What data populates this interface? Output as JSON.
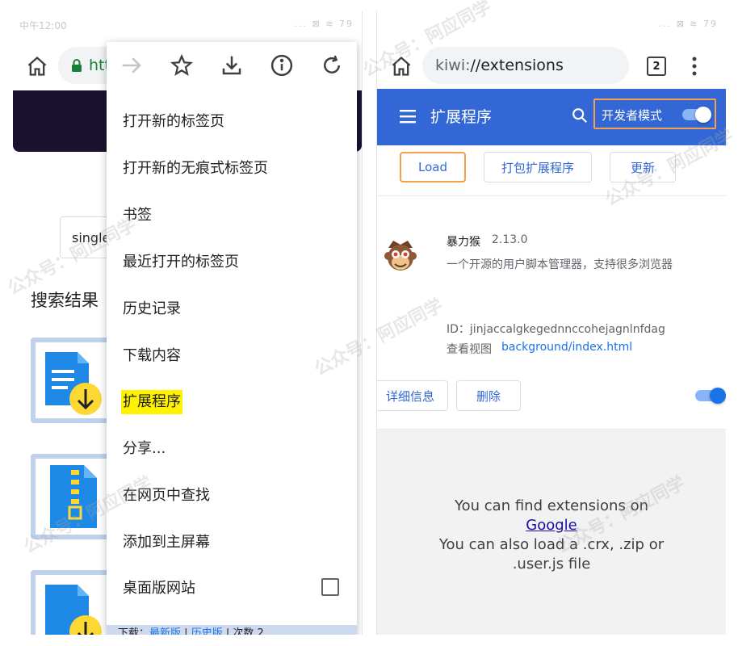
{
  "left_phone": {
    "status": {
      "time": "中午12:00",
      "sys": "... ⊠ ≋ 79"
    },
    "url_prefix": "htt",
    "search_value": "single",
    "results_title": "搜索结果",
    "menu": {
      "icons": [
        "forward-arrow-icon",
        "star-icon",
        "download-icon",
        "info-icon",
        "refresh-icon"
      ],
      "items": [
        "打开新的标签页",
        "打开新的无痕式标签页",
        "书签",
        "最近打开的标签页",
        "历史记录",
        "下载内容",
        "扩展程序",
        "分享...",
        "在网页中查找",
        "添加到主屏幕",
        "桌面版网站"
      ],
      "highlight_color": "#fff200",
      "bottom_strip": {
        "prefix": "下载：",
        "link1": "最新版",
        "sep": " | ",
        "link2": "历史版",
        "suffix": " | 次数 2"
      }
    }
  },
  "right_phone": {
    "status": {
      "time": "",
      "sys": "... ⊠ ≋ 79"
    },
    "url": {
      "scheme": "kiwi:",
      "rest": "//extensions"
    },
    "tab_count": "2",
    "header": {
      "title": "扩展程序",
      "dev_mode_label": "开发者模式",
      "bg_color": "#3367d6"
    },
    "actions": {
      "load": "Load",
      "pack": "打包扩展程序",
      "update": "更新"
    },
    "extension": {
      "name": "暴力猴",
      "version": "2.13.0",
      "description": "一个开源的用户脚本管理器，支持很多浏览器",
      "id": "ID：jinjaccalgkegednnccohejagnlnfdag",
      "views_label": "查看视图",
      "views_link": "background/index.html",
      "details_btn": "详细信息",
      "remove_btn": "删除"
    },
    "hints": {
      "line1": "You can find extensions on",
      "link": "Google",
      "line2": "You can also load a .crx, .zip or",
      "line3": ".user.js file"
    }
  },
  "watermark_text": "公众号：阿应同学",
  "accent_orange": "#f6a04d"
}
